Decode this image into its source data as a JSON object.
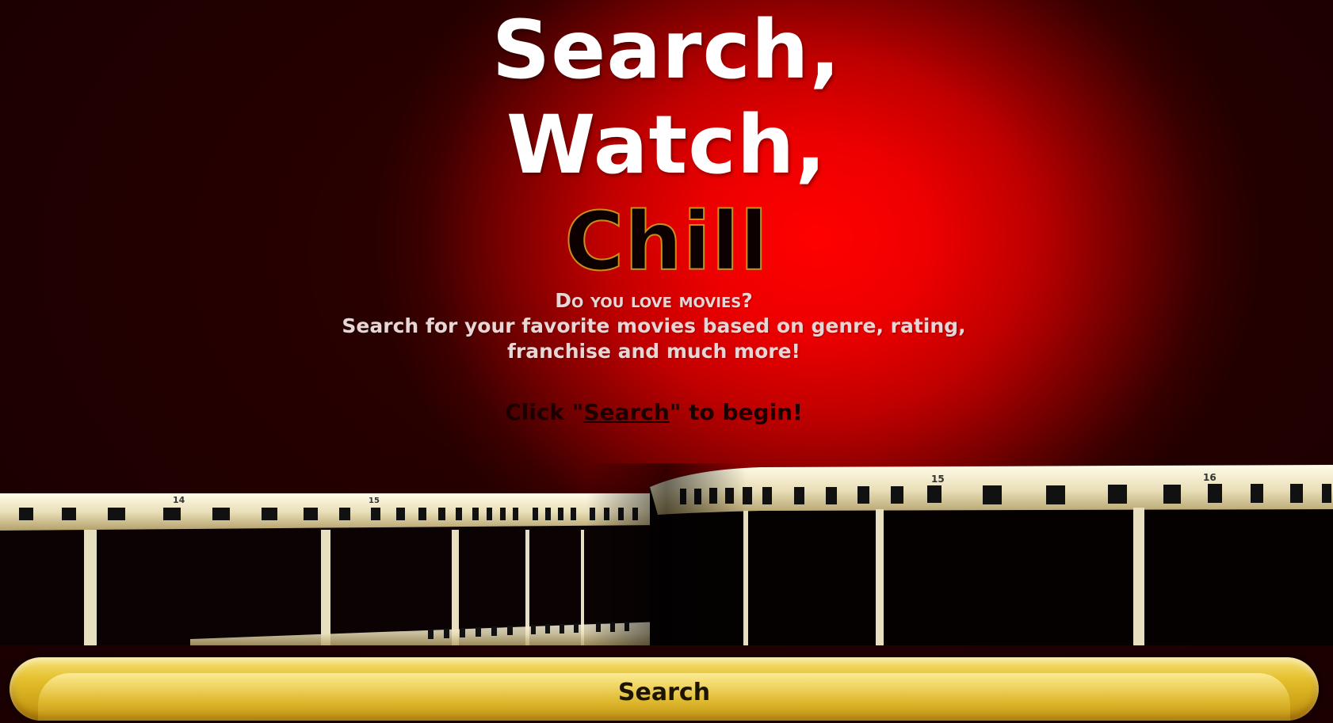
{
  "headline": {
    "line1": "Search,",
    "line2": "Watch,",
    "line3": "Chill"
  },
  "intro": {
    "question": "Do you love movies?",
    "line2": "Search for your favorite movies based on genre, rating,",
    "line3": "franchise and much more!"
  },
  "cta": {
    "prefix": "Click \"",
    "link": "Search",
    "suffix": "\" to begin!"
  },
  "film_strip": {
    "frame_numbers": [
      "14",
      "15",
      "15",
      "16"
    ]
  },
  "search_button": {
    "label": "Search"
  },
  "colors": {
    "background_red": "#ff0000",
    "background_dark": "#280000",
    "gold": "#e4bf2c",
    "chill_outline": "#c98d1c"
  }
}
